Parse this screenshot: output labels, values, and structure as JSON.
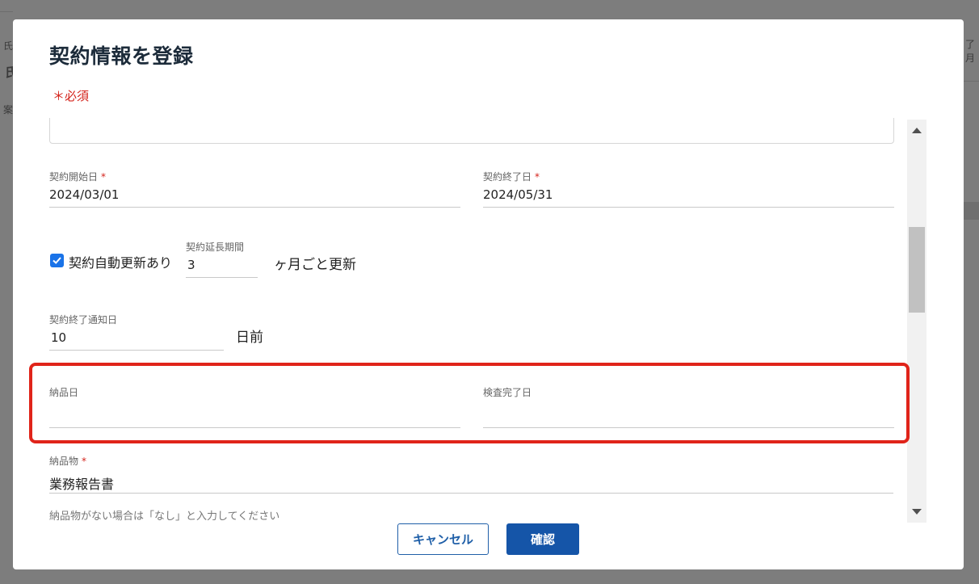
{
  "background": {
    "frag_top_left": "氏",
    "frag_left_bold": "氏",
    "frag_left_mid": "案",
    "frag_top_right": "了月"
  },
  "modal": {
    "title": "契約情報を登録",
    "required_note": "＊必須"
  },
  "form": {
    "contract_start": {
      "label": "契約開始日",
      "required_mark": "*",
      "value": "2024/03/01"
    },
    "contract_end": {
      "label": "契約終了日",
      "required_mark": "*",
      "value": "2024/05/31"
    },
    "auto_renew": {
      "label": "契約自動更新あり",
      "checked": true
    },
    "extension_period": {
      "label": "契約延長期間",
      "value": "3",
      "unit": "ヶ月ごと更新"
    },
    "end_notice": {
      "label": "契約終了通知日",
      "value": "10",
      "unit": "日前"
    },
    "delivery_date": {
      "label": "納品日",
      "value": ""
    },
    "inspection_date": {
      "label": "検査完了日",
      "value": ""
    },
    "deliverable": {
      "label": "納品物",
      "required_mark": "*",
      "value": "業務報告書",
      "helper": "納品物がない場合は「なし」と入力してください"
    }
  },
  "buttons": {
    "cancel": "キャンセル",
    "confirm": "確認"
  },
  "colors": {
    "accent": "#1555a8",
    "required": "#d4241c",
    "highlight": "#e0241a",
    "checkbox": "#1a73e8"
  }
}
